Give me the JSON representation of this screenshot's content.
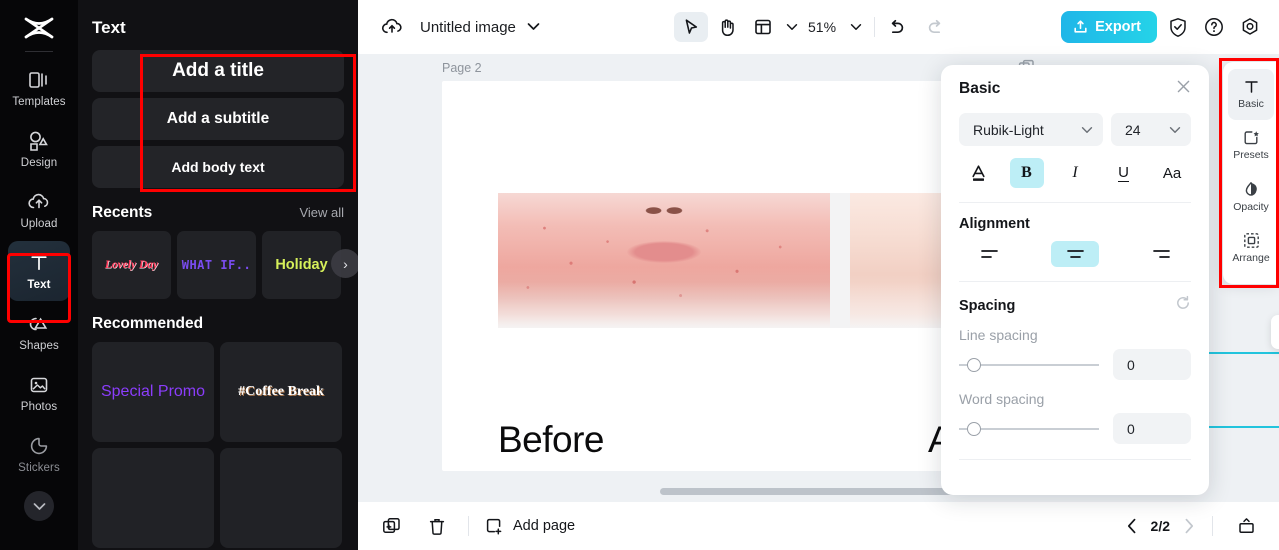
{
  "rail": {
    "logo": "capcut-logo",
    "items": [
      {
        "label": "Templates",
        "icon": "templates-icon",
        "active": false
      },
      {
        "label": "Design",
        "icon": "design-icon",
        "active": false
      },
      {
        "label": "Upload",
        "icon": "upload-cloud-icon",
        "active": false
      },
      {
        "label": "Text",
        "icon": "text-icon",
        "active": true
      },
      {
        "label": "Shapes",
        "icon": "shapes-icon",
        "active": false
      },
      {
        "label": "Photos",
        "icon": "photos-icon",
        "active": false
      },
      {
        "label": "Stickers",
        "icon": "stickers-icon",
        "active": false
      }
    ],
    "more": "chevron-down-icon"
  },
  "panel": {
    "title": "Text",
    "text_buttons": [
      {
        "label": "Add a title"
      },
      {
        "label": "Add a subtitle"
      },
      {
        "label": "Add body text"
      }
    ],
    "recents": {
      "title": "Recents",
      "view_all": "View all",
      "cards": [
        {
          "label": "Lovely Day"
        },
        {
          "label": "WHAT IF.."
        },
        {
          "label": "Holiday"
        }
      ],
      "next_arrow": "›"
    },
    "recommended": {
      "title": "Recommended",
      "cards": [
        {
          "label": "Special Promo"
        },
        {
          "label": "#Coffee Break"
        },
        {
          "label": ""
        },
        {
          "label": ""
        }
      ]
    }
  },
  "topbar": {
    "cloud_icon": "cloud-save-icon",
    "doc_title": "Untitled image",
    "doc_caret": "chevron-down-icon",
    "tools": [
      {
        "name": "select-tool",
        "icon": "cursor-arrow-icon",
        "selected": true
      },
      {
        "name": "hand-tool",
        "icon": "hand-icon",
        "selected": false
      },
      {
        "name": "layout-tool",
        "icon": "layout-grid-icon",
        "selected": false
      }
    ],
    "zoom": "51%",
    "zoom_caret": "chevron-down-icon",
    "undo": "undo-icon",
    "redo": "redo-icon",
    "export_label": "Export",
    "export_icon": "upload-box-icon",
    "right_icons": [
      "shield-check-icon",
      "help-circle-icon",
      "settings-gear-icon"
    ],
    "accent": "#22c4dd"
  },
  "canvas": {
    "page_label": "Page 2",
    "page_tools": [
      "duplicate-page-icon",
      "more-options-icon"
    ],
    "captions": {
      "before": "Before",
      "after": "Af"
    },
    "float_tools": [
      "duplicate-icon",
      "opacity-icon"
    ],
    "selection_color": "#22c4dd"
  },
  "props": {
    "title": "Basic",
    "close": "close-icon",
    "font_name": "Rubik-Light",
    "font_size": "24",
    "style_buttons": [
      {
        "name": "text-color-button",
        "glyph": "A",
        "on": false
      },
      {
        "name": "bold-button",
        "glyph": "B",
        "on": true
      },
      {
        "name": "italic-button",
        "glyph": "I",
        "on": false
      },
      {
        "name": "underline-button",
        "glyph": "U",
        "on": false
      },
      {
        "name": "case-button",
        "glyph": "Aa",
        "on": false
      }
    ],
    "alignment_title": "Alignment",
    "alignment": [
      {
        "name": "align-left-button",
        "on": false
      },
      {
        "name": "align-center-button",
        "on": true
      },
      {
        "name": "align-right-button",
        "on": false
      }
    ],
    "spacing_title": "Spacing",
    "spacing_reset": "reset-icon",
    "line_spacing_label": "Line spacing",
    "line_spacing_value": "0",
    "word_spacing_label": "Word spacing",
    "word_spacing_value": "0"
  },
  "rrail": {
    "items": [
      {
        "label": "Basic",
        "icon": "text-basic-icon",
        "active": true
      },
      {
        "label": "Presets",
        "icon": "presets-icon",
        "active": false
      },
      {
        "label": "Opacity",
        "icon": "opacity-drop-icon",
        "active": false
      },
      {
        "label": "Arrange",
        "icon": "arrange-icon",
        "active": false
      }
    ]
  },
  "bottombar": {
    "duplicate_icon": "duplicate-page-icon",
    "delete_icon": "trash-icon",
    "add_page_icon": "add-page-icon",
    "add_page_label": "Add page",
    "prev_icon": "chevron-left-icon",
    "page_count": "2/2",
    "next_icon": "chevron-right-icon",
    "present_icon": "present-icon"
  },
  "highlights": {
    "color": "#ff0000"
  }
}
